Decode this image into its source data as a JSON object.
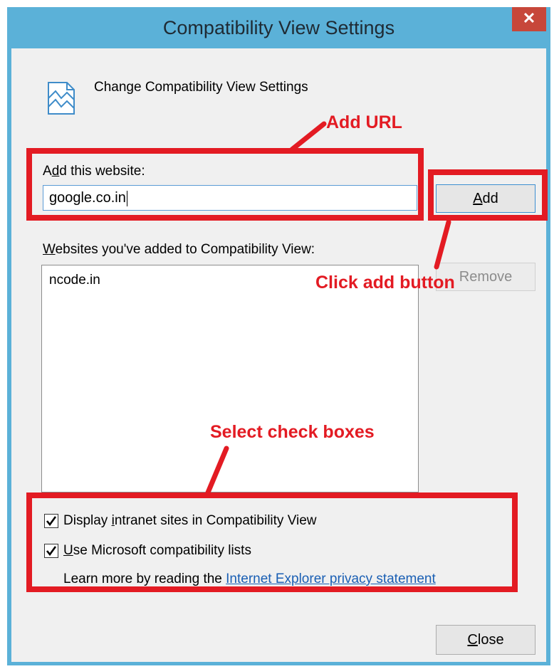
{
  "window": {
    "title": "Compatibility View Settings",
    "close_glyph": "✕"
  },
  "header": {
    "text": "Change Compatibility View Settings",
    "icon": "compat-view-page-icon"
  },
  "add_section": {
    "label_pre": "A",
    "label_access": "d",
    "label_post": "d this website:",
    "input_value": "google.co.in",
    "add_button_access": "A",
    "add_button_rest": "dd"
  },
  "list_section": {
    "label_access": "W",
    "label_post": "ebsites you've added to Compatibility View:",
    "items": [
      "ncode.in"
    ],
    "remove_button": "Remove"
  },
  "options": {
    "intranet_pre": "Display ",
    "intranet_access": "i",
    "intranet_post": "ntranet sites in Compatibility View",
    "intranet_checked": true,
    "mslists_access": "U",
    "mslists_post": "se Microsoft compatibility lists",
    "mslists_checked": true,
    "learn_more_text": "Learn more by reading the ",
    "learn_more_link": "Internet Explorer privacy statement"
  },
  "footer": {
    "close_access": "C",
    "close_rest": "lose"
  },
  "annotations": {
    "add_url": "Add URL",
    "click_add": "Click add button",
    "select_checks": "Select check boxes",
    "color": "#e31b23"
  }
}
